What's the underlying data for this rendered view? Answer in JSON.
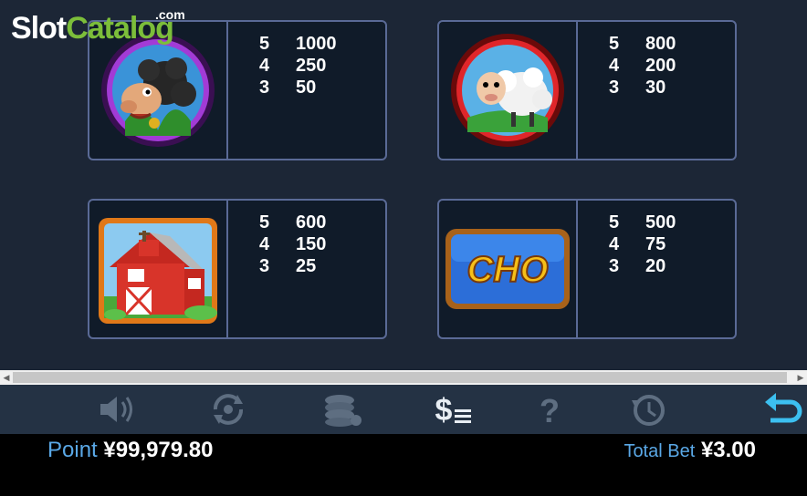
{
  "logo": {
    "slot": "Slot",
    "catalog": "Catalog",
    "com": ".com"
  },
  "symbols": [
    {
      "name": "black-sheep",
      "pays": [
        {
          "count": "5",
          "amount": "1000"
        },
        {
          "count": "4",
          "amount": "250"
        },
        {
          "count": "3",
          "amount": "50"
        }
      ]
    },
    {
      "name": "white-sheep",
      "pays": [
        {
          "count": "5",
          "amount": "800"
        },
        {
          "count": "4",
          "amount": "200"
        },
        {
          "count": "3",
          "amount": "30"
        }
      ]
    },
    {
      "name": "red-barn",
      "pays": [
        {
          "count": "5",
          "amount": "600"
        },
        {
          "count": "4",
          "amount": "150"
        },
        {
          "count": "3",
          "amount": "25"
        }
      ]
    },
    {
      "name": "cho-sign",
      "sign_text": "CHO",
      "pays": [
        {
          "count": "5",
          "amount": "500"
        },
        {
          "count": "4",
          "amount": "75"
        },
        {
          "count": "3",
          "amount": "20"
        }
      ]
    }
  ],
  "toolbar": {
    "buttons": [
      "sound-icon",
      "autoplay-icon",
      "bet-chips-icon",
      "paytable-icon",
      "help-icon",
      "history-icon",
      "back-icon"
    ]
  },
  "status": {
    "point_label": "Point",
    "point_value": "¥99,979.80",
    "total_bet_label": "Total Bet",
    "total_bet_value": "¥3.00"
  },
  "colors": {
    "accent_blue": "#5aa8e6",
    "border": "#5a6a96",
    "logo_green": "#7cbe3a"
  }
}
